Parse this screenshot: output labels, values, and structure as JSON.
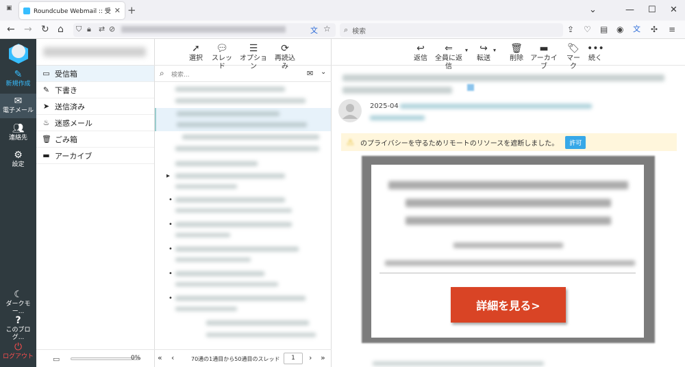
{
  "browser": {
    "tab_title": "Roundcube Webmail :: 受信箱",
    "search_placeholder": "検索"
  },
  "rail": {
    "compose": "新規作成",
    "mail": "電子メール",
    "contacts": "連絡先",
    "settings": "設定",
    "dark_mode": "ダークモー...",
    "about": "このブログ...",
    "logout": "ログアウト"
  },
  "folders": [
    {
      "label": "受信箱",
      "icon": "inbox-icon"
    },
    {
      "label": "下書き",
      "icon": "pencil-icon"
    },
    {
      "label": "送信済み",
      "icon": "paper-plane-icon"
    },
    {
      "label": "迷惑メール",
      "icon": "fire-icon"
    },
    {
      "label": "ごみ箱",
      "icon": "trash-icon"
    },
    {
      "label": "アーカイブ",
      "icon": "archive-icon"
    }
  ],
  "quota": {
    "percent_label": "0%"
  },
  "list_toolbar": {
    "select": "選択",
    "threads": "スレッド",
    "options": "オプション",
    "refresh": "再読込み"
  },
  "list_search": {
    "placeholder": "検索..."
  },
  "list_footer": {
    "count_text": "70通の1通目から50通目のスレッド",
    "page": "1"
  },
  "preview_toolbar": {
    "reply": "返信",
    "reply_all": "全員に返信",
    "forward": "転送",
    "delete": "削除",
    "archive": "アーカイブ",
    "mark": "マーク",
    "more": "続く"
  },
  "preview": {
    "date_fragment": "2025-04",
    "notice": "のプライバシーを守るためリモートのリソースを遮断しました。",
    "allow": "許可",
    "cta": "詳細を見る>"
  },
  "colors": {
    "rail": "#2f3a3f",
    "accent": "#37a8e8",
    "cta": "#d94425",
    "logout": "#ff4d4d"
  }
}
